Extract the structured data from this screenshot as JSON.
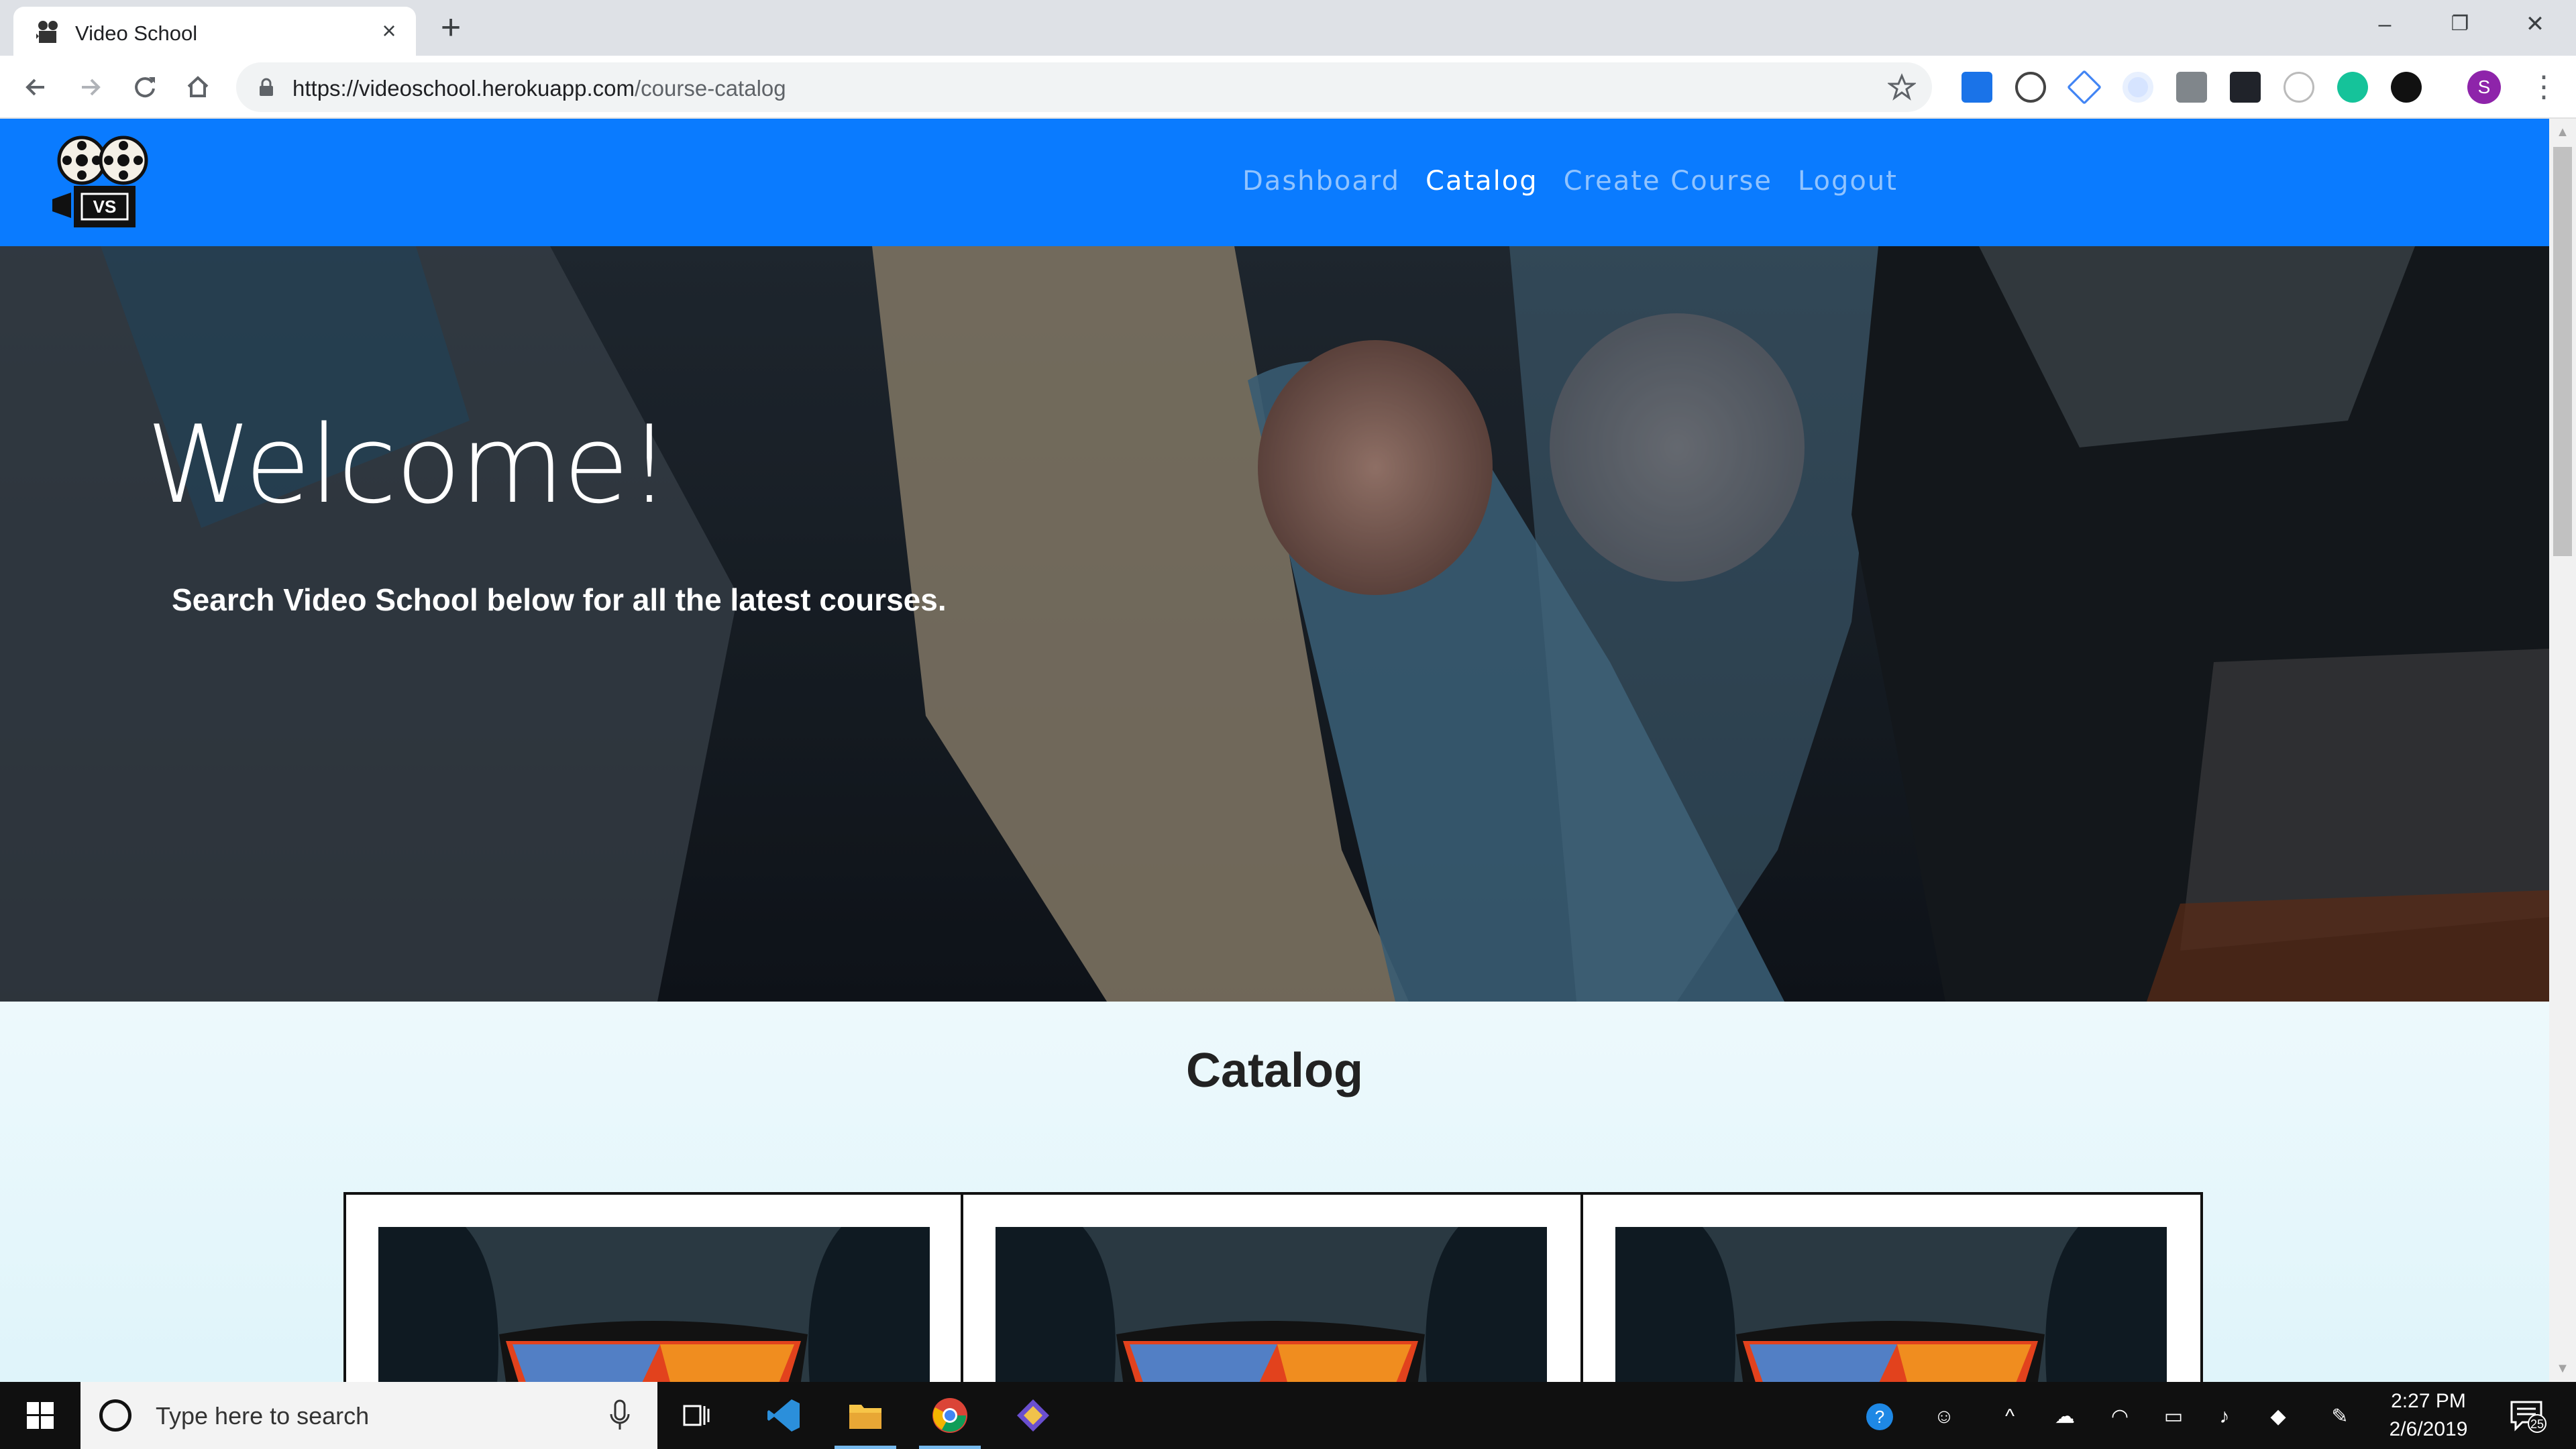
{
  "browser": {
    "tab_title": "Video School",
    "new_tab_symbol": "+",
    "tab_close_symbol": "×",
    "url_host": "https://videoschool.herokuapp.com",
    "url_path": "/course-catalog",
    "profile_initial": "S",
    "window_controls": {
      "minimize": "–",
      "restore": "❐",
      "close": "✕"
    },
    "extensions": [
      "text-tool-icon",
      "code-brackets-icon",
      "drive-icon",
      "extension-dot-icon",
      "dev-tools-icon",
      "react-icon",
      "face-icon",
      "grammarly-icon",
      "chat-icon"
    ]
  },
  "site": {
    "nav": {
      "links": [
        {
          "label": "Dashboard",
          "active": false
        },
        {
          "label": "Catalog",
          "active": true
        },
        {
          "label": "Create Course",
          "active": false
        },
        {
          "label": "Logout",
          "active": false
        }
      ]
    },
    "logo_text": "VS",
    "hero": {
      "title": "Welcome!",
      "subtitle": "Search Video School below for all the latest courses."
    },
    "catalog": {
      "heading": "Catalog",
      "cards": [
        {},
        {},
        {}
      ]
    }
  },
  "taskbar": {
    "search_placeholder": "Type here to search",
    "time": "2:27 PM",
    "date": "2/6/2019",
    "notification_count": "25"
  },
  "colors": {
    "nav_blue": "#0a7bff",
    "taskbar": "#101010",
    "profile": "#8e24aa"
  }
}
